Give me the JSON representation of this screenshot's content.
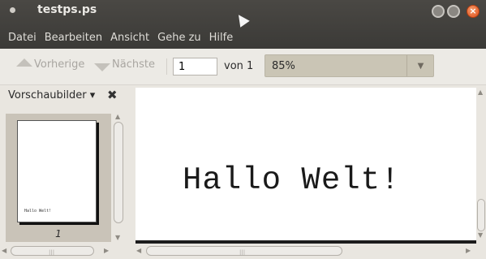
{
  "window": {
    "title": "testps.ps"
  },
  "menu": [
    "Datei",
    "Bearbeiten",
    "Ansicht",
    "Gehe zu",
    "Hilfe"
  ],
  "toolbar": {
    "prev_label": "Vorherige",
    "next_label": "Nächste",
    "page_value": "1",
    "page_of": "von 1",
    "zoom_value": "85%"
  },
  "sidebar": {
    "title": "Vorschaubilder ▾",
    "thumbnail_text": "Hallo Welt!",
    "thumbnail_page_number": "1"
  },
  "document": {
    "text": "Hallo Welt!"
  },
  "colors": {
    "titlebar": "#3b3a37",
    "zoom_bg": "#cac5b5",
    "close_button": "#e0501b"
  },
  "icons": [
    "menu-dot-icon",
    "minimize-icon",
    "maximize-icon",
    "close-icon",
    "arrow-up-icon",
    "arrow-down-icon",
    "chevron-down-icon",
    "sidebar-close-icon",
    "mouse-cursor-icon"
  ]
}
